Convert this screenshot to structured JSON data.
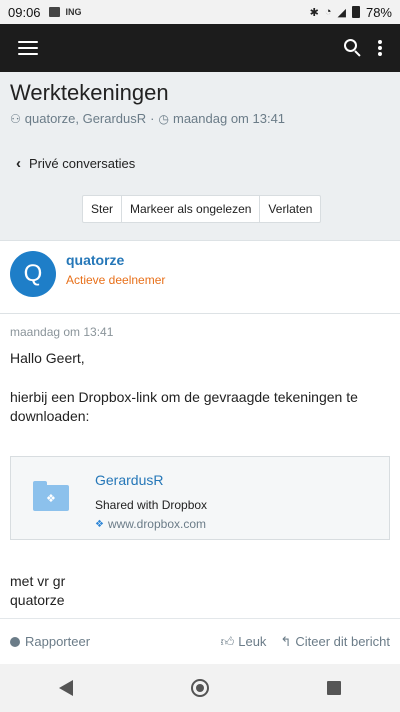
{
  "status_bar": {
    "time": "09:06",
    "carrier": "ING",
    "battery": "78%"
  },
  "thread": {
    "title": "Werktekeningen",
    "participants": "quatorze, GerardusR",
    "separator": "·",
    "date": "maandag om 13:41",
    "back_label": "Privé conversaties"
  },
  "thread_actions": {
    "star": "Ster",
    "mark_unread": "Markeer als ongelezen",
    "leave": "Verlaten"
  },
  "author": {
    "initial": "Q",
    "name": "quatorze",
    "role": "Actieve deelnemer",
    "avatar_color": "#1e7ec8",
    "role_color": "#e8701a"
  },
  "message": {
    "date": "maandag om 13:41",
    "greeting": "Hallo Geert,",
    "paragraph": "hierbij een Dropbox-link om de gevraagde tekeningen te downloaden:",
    "closing_line1": "met vr gr",
    "closing_line2": "quatorze"
  },
  "embed": {
    "title": "GerardusR",
    "subtitle": "Shared with Dropbox",
    "link": "www.dropbox.com"
  },
  "post_actions": {
    "report": "Rapporteer",
    "like": "Leuk",
    "quote": "Citeer dit bericht"
  },
  "icons": [
    "menu-icon",
    "search-icon",
    "more-icon",
    "users-icon",
    "clock-icon",
    "chevron-left-icon",
    "folder-icon",
    "dropbox-icon",
    "info-icon",
    "thumbs-up-icon",
    "reply-icon",
    "nav-back-icon",
    "nav-home-icon",
    "nav-recent-icon"
  ]
}
